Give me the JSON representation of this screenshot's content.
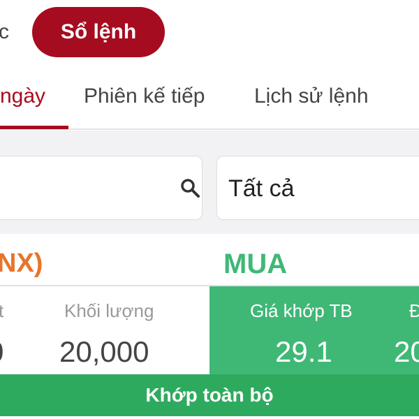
{
  "header": {
    "prev_label": "c",
    "order_book_button": "Sổ lệnh"
  },
  "tabs": [
    {
      "label": "ngày",
      "active": true
    },
    {
      "label": "Phiên kế tiếp",
      "active": false
    },
    {
      "label": "Lịch sử lệnh",
      "active": false
    }
  ],
  "filters": {
    "search_icon": "search-icon",
    "status_select_value": "Tất cả"
  },
  "order": {
    "exchange": "NX)",
    "side": "MUA",
    "cut_left_label": "t",
    "cut_left_value": "0",
    "volume_label": "Khối lượng",
    "volume_value": "20,000",
    "avg_price_label": "Giá khớp TB",
    "avg_price_value": "29.1",
    "cut_right_label": "Đ",
    "cut_right_value": "20",
    "status": "Khớp toàn bộ"
  },
  "colors": {
    "brand_red": "#a60c1f",
    "buy_green": "#3fb876",
    "status_green": "#2eaa5e",
    "exchange_orange": "#e8742a"
  }
}
